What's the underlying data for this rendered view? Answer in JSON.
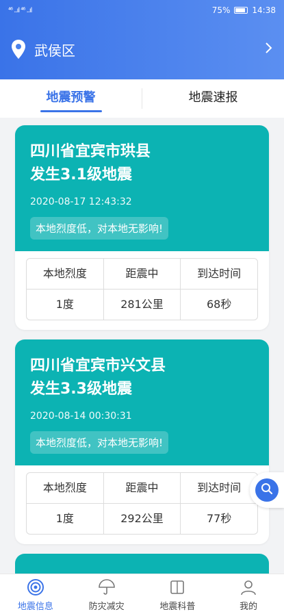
{
  "status": {
    "signal_left": "⁴⁶ ..ıl  ⁴⁶ ..ıl",
    "battery": "75%",
    "time": "14:38"
  },
  "location": {
    "name": "武侯区"
  },
  "tabs": [
    {
      "label": "地震预警",
      "active": true
    },
    {
      "label": "地震速报",
      "active": false
    }
  ],
  "table_headers": [
    "本地烈度",
    "距震中",
    "到达时间"
  ],
  "cards": [
    {
      "title_line1": "四川省宜宾市珙县",
      "title_line2": "发生3.1级地震",
      "time": "2020-08-17 12:43:32",
      "note": "本地烈度低，对本地无影响!",
      "intensity": "1度",
      "distance": "281公里",
      "arrival": "68秒"
    },
    {
      "title_line1": "四川省宜宾市兴文县",
      "title_line2": "发生3.3级地震",
      "time": "2020-08-14 00:30:31",
      "note": "本地烈度低，对本地无影响!",
      "intensity": "1度",
      "distance": "292公里",
      "arrival": "77秒"
    }
  ],
  "bottom_nav": [
    {
      "label": "地震信息",
      "icon": "quake-info-icon",
      "active": true
    },
    {
      "label": "防灾减灾",
      "icon": "umbrella-icon",
      "active": false
    },
    {
      "label": "地震科普",
      "icon": "book-icon",
      "active": false
    },
    {
      "label": "我的",
      "icon": "user-icon",
      "active": false
    }
  ],
  "colors": {
    "brand_blue": "#3a73e8",
    "card_teal": "#0cb3b3"
  }
}
